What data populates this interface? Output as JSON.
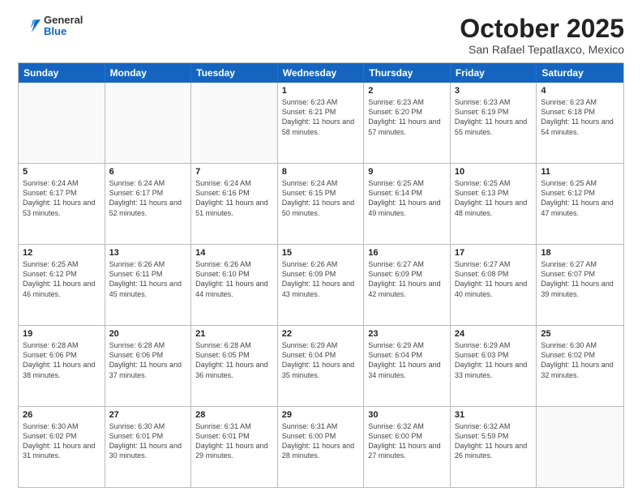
{
  "header": {
    "logo": {
      "general": "General",
      "blue": "Blue"
    },
    "title": "October 2025",
    "subtitle": "San Rafael Tepatlaxco, Mexico"
  },
  "days_of_week": [
    "Sunday",
    "Monday",
    "Tuesday",
    "Wednesday",
    "Thursday",
    "Friday",
    "Saturday"
  ],
  "weeks": [
    [
      {
        "day": "",
        "info": ""
      },
      {
        "day": "",
        "info": ""
      },
      {
        "day": "",
        "info": ""
      },
      {
        "day": "1",
        "info": "Sunrise: 6:23 AM\nSunset: 6:21 PM\nDaylight: 11 hours and 58 minutes."
      },
      {
        "day": "2",
        "info": "Sunrise: 6:23 AM\nSunset: 6:20 PM\nDaylight: 11 hours and 57 minutes."
      },
      {
        "day": "3",
        "info": "Sunrise: 6:23 AM\nSunset: 6:19 PM\nDaylight: 11 hours and 55 minutes."
      },
      {
        "day": "4",
        "info": "Sunrise: 6:23 AM\nSunset: 6:18 PM\nDaylight: 11 hours and 54 minutes."
      }
    ],
    [
      {
        "day": "5",
        "info": "Sunrise: 6:24 AM\nSunset: 6:17 PM\nDaylight: 11 hours and 53 minutes."
      },
      {
        "day": "6",
        "info": "Sunrise: 6:24 AM\nSunset: 6:17 PM\nDaylight: 11 hours and 52 minutes."
      },
      {
        "day": "7",
        "info": "Sunrise: 6:24 AM\nSunset: 6:16 PM\nDaylight: 11 hours and 51 minutes."
      },
      {
        "day": "8",
        "info": "Sunrise: 6:24 AM\nSunset: 6:15 PM\nDaylight: 11 hours and 50 minutes."
      },
      {
        "day": "9",
        "info": "Sunrise: 6:25 AM\nSunset: 6:14 PM\nDaylight: 11 hours and 49 minutes."
      },
      {
        "day": "10",
        "info": "Sunrise: 6:25 AM\nSunset: 6:13 PM\nDaylight: 11 hours and 48 minutes."
      },
      {
        "day": "11",
        "info": "Sunrise: 6:25 AM\nSunset: 6:12 PM\nDaylight: 11 hours and 47 minutes."
      }
    ],
    [
      {
        "day": "12",
        "info": "Sunrise: 6:25 AM\nSunset: 6:12 PM\nDaylight: 11 hours and 46 minutes."
      },
      {
        "day": "13",
        "info": "Sunrise: 6:26 AM\nSunset: 6:11 PM\nDaylight: 11 hours and 45 minutes."
      },
      {
        "day": "14",
        "info": "Sunrise: 6:26 AM\nSunset: 6:10 PM\nDaylight: 11 hours and 44 minutes."
      },
      {
        "day": "15",
        "info": "Sunrise: 6:26 AM\nSunset: 6:09 PM\nDaylight: 11 hours and 43 minutes."
      },
      {
        "day": "16",
        "info": "Sunrise: 6:27 AM\nSunset: 6:09 PM\nDaylight: 11 hours and 42 minutes."
      },
      {
        "day": "17",
        "info": "Sunrise: 6:27 AM\nSunset: 6:08 PM\nDaylight: 11 hours and 40 minutes."
      },
      {
        "day": "18",
        "info": "Sunrise: 6:27 AM\nSunset: 6:07 PM\nDaylight: 11 hours and 39 minutes."
      }
    ],
    [
      {
        "day": "19",
        "info": "Sunrise: 6:28 AM\nSunset: 6:06 PM\nDaylight: 11 hours and 38 minutes."
      },
      {
        "day": "20",
        "info": "Sunrise: 6:28 AM\nSunset: 6:06 PM\nDaylight: 11 hours and 37 minutes."
      },
      {
        "day": "21",
        "info": "Sunrise: 6:28 AM\nSunset: 6:05 PM\nDaylight: 11 hours and 36 minutes."
      },
      {
        "day": "22",
        "info": "Sunrise: 6:29 AM\nSunset: 6:04 PM\nDaylight: 11 hours and 35 minutes."
      },
      {
        "day": "23",
        "info": "Sunrise: 6:29 AM\nSunset: 6:04 PM\nDaylight: 11 hours and 34 minutes."
      },
      {
        "day": "24",
        "info": "Sunrise: 6:29 AM\nSunset: 6:03 PM\nDaylight: 11 hours and 33 minutes."
      },
      {
        "day": "25",
        "info": "Sunrise: 6:30 AM\nSunset: 6:02 PM\nDaylight: 11 hours and 32 minutes."
      }
    ],
    [
      {
        "day": "26",
        "info": "Sunrise: 6:30 AM\nSunset: 6:02 PM\nDaylight: 11 hours and 31 minutes."
      },
      {
        "day": "27",
        "info": "Sunrise: 6:30 AM\nSunset: 6:01 PM\nDaylight: 11 hours and 30 minutes."
      },
      {
        "day": "28",
        "info": "Sunrise: 6:31 AM\nSunset: 6:01 PM\nDaylight: 11 hours and 29 minutes."
      },
      {
        "day": "29",
        "info": "Sunrise: 6:31 AM\nSunset: 6:00 PM\nDaylight: 11 hours and 28 minutes."
      },
      {
        "day": "30",
        "info": "Sunrise: 6:32 AM\nSunset: 6:00 PM\nDaylight: 11 hours and 27 minutes."
      },
      {
        "day": "31",
        "info": "Sunrise: 6:32 AM\nSunset: 5:59 PM\nDaylight: 11 hours and 26 minutes."
      },
      {
        "day": "",
        "info": ""
      }
    ]
  ]
}
